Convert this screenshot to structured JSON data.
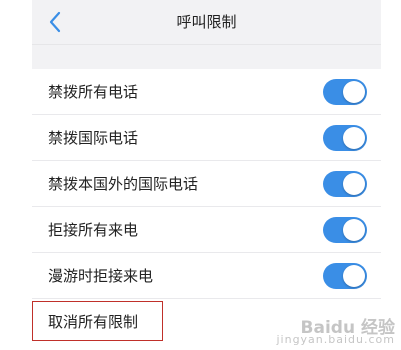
{
  "header": {
    "title": "呼叫限制",
    "back_icon": "chevron-left-icon"
  },
  "colors": {
    "accent": "#3a8ee6",
    "highlight_border": "#c0302a",
    "header_bg": "#f2f2f4"
  },
  "settings": {
    "items": [
      {
        "label": "禁拨所有电话",
        "toggle": "on"
      },
      {
        "label": "禁拨国际电话",
        "toggle": "on"
      },
      {
        "label": "禁拨本国外的国际电话",
        "toggle": "on"
      },
      {
        "label": "拒接所有来电",
        "toggle": "on"
      },
      {
        "label": "漫游时拒接来电",
        "toggle": "on"
      }
    ],
    "cancel_label": "取消所有限制"
  },
  "watermark": {
    "text": "Baidu 经验",
    "subtext": "jingyan.baidu.com"
  }
}
